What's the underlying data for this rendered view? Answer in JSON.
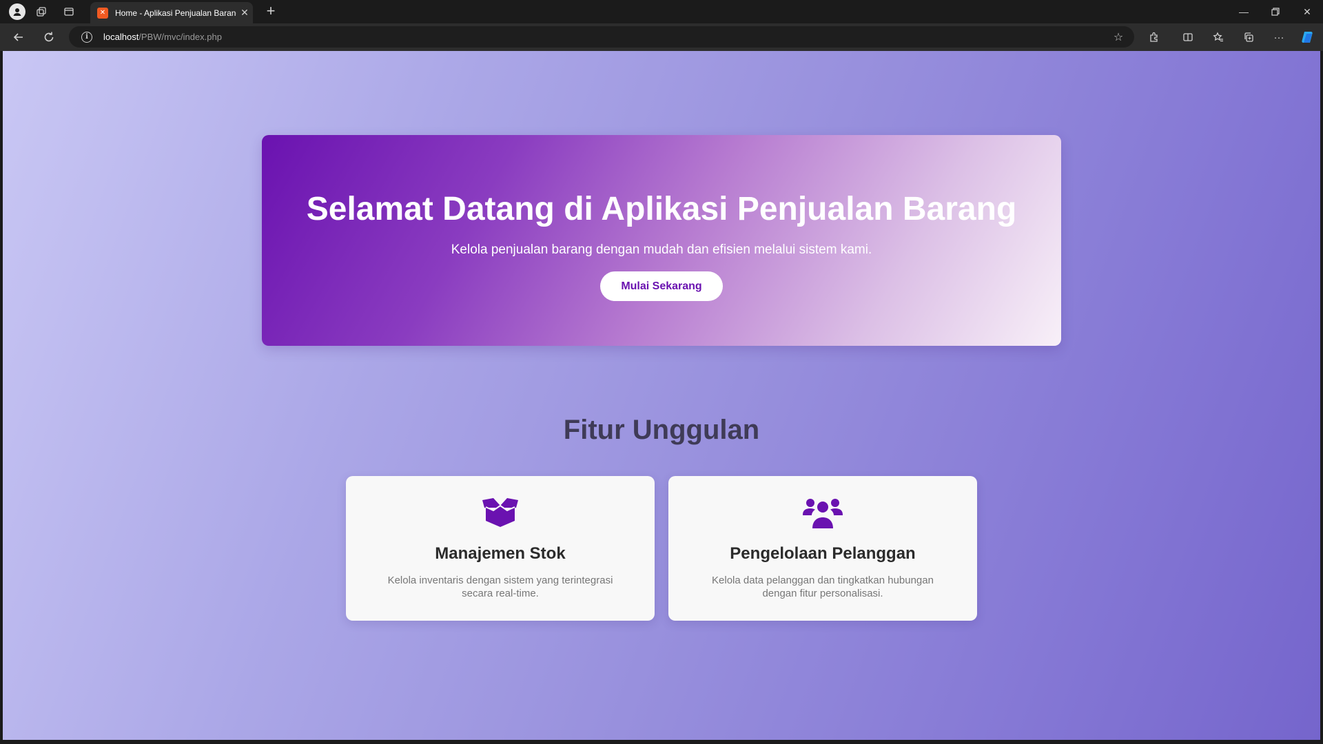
{
  "browser": {
    "tab_title": "Home - Aplikasi Penjualan Barang",
    "url_host": "localhost",
    "url_path": "/PBW/mvc/index.php"
  },
  "hero": {
    "title": "Selamat Datang di Aplikasi Penjualan Barang",
    "subtitle": "Kelola penjualan barang dengan mudah dan efisien melalui sistem kami.",
    "cta_label": "Mulai Sekarang"
  },
  "features": {
    "title": "Fitur Unggulan",
    "items": [
      {
        "icon": "box-open-icon",
        "title": "Manajemen Stok",
        "description": "Kelola inventaris dengan sistem yang terintegrasi secara real-time."
      },
      {
        "icon": "users-icon",
        "title": "Pengelolaan Pelanggan",
        "description": "Kelola data pelanggan dan tingkatkan hubungan dengan fitur personalisasi."
      }
    ]
  },
  "colors": {
    "accent": "#6a12b0",
    "page_bg_start": "#c9c7f4",
    "page_bg_end": "#7565cc"
  }
}
